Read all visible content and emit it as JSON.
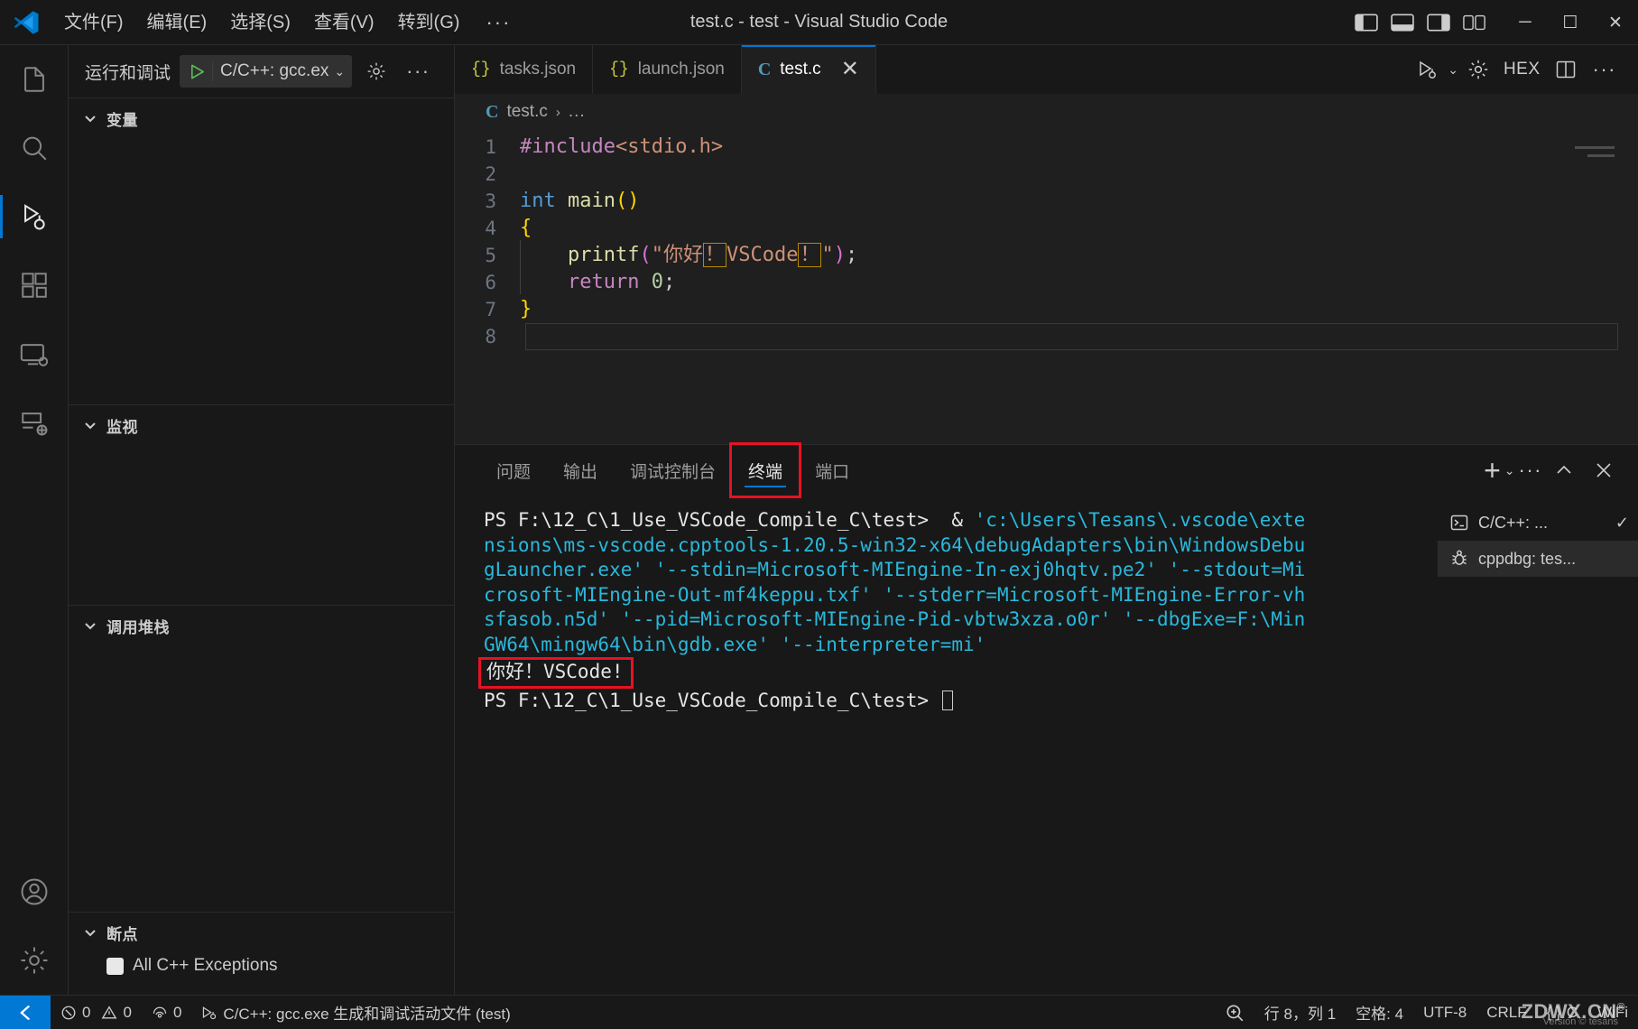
{
  "titlebar": {
    "window_title": "test.c - test - Visual Studio Code",
    "menus": [
      "文件(F)",
      "编辑(E)",
      "选择(S)",
      "查看(V)",
      "转到(G)"
    ],
    "more_label": "···",
    "minimize": "─",
    "maximize": "☐",
    "close": "✕"
  },
  "activitybar": {
    "items": [
      {
        "name": "explorer",
        "title": "资源管理器"
      },
      {
        "name": "search",
        "title": "搜索"
      },
      {
        "name": "run-debug",
        "title": "运行和调试"
      },
      {
        "name": "extensions",
        "title": "扩展"
      },
      {
        "name": "remote-explorer",
        "title": "远程资源管理器"
      },
      {
        "name": "testing",
        "title": "测试"
      }
    ],
    "bottom": [
      {
        "name": "accounts",
        "title": "账户"
      },
      {
        "name": "settings",
        "title": "管理"
      }
    ]
  },
  "sidebar": {
    "toolbar": {
      "label": "运行和调试",
      "launch_config": "C/C++: gcc.ex",
      "chevron": "⌄",
      "gear_title": "打开“launch.json”",
      "more": "···"
    },
    "panes": [
      {
        "title": "变量",
        "chevron": "⌄"
      },
      {
        "title": "监视",
        "chevron": "⌄"
      },
      {
        "title": "调用堆栈",
        "chevron": "⌄"
      },
      {
        "title": "断点",
        "chevron": "⌄"
      }
    ],
    "breakpoint_item": "All C++ Exceptions"
  },
  "editor": {
    "tabs": [
      {
        "label": "tasks.json",
        "icon": "{}",
        "active": false
      },
      {
        "label": "launch.json",
        "icon": "{}",
        "active": false
      },
      {
        "label": "test.c",
        "icon": "C",
        "active": true
      }
    ],
    "tab_close": "✕",
    "actions": {
      "run_label": "运行或调试",
      "chevron": "⌄",
      "gear": "设置",
      "hex": "HEX",
      "split": "拆分编辑器",
      "more": "···"
    },
    "breadcrumb": {
      "icon": "C",
      "file": "test.c",
      "separator": "›",
      "more": "..."
    },
    "code_lines": [
      {
        "n": "1",
        "text": "#include<stdio.h>"
      },
      {
        "n": "2",
        "text": ""
      },
      {
        "n": "3",
        "text": "int main()"
      },
      {
        "n": "4",
        "text": "{"
      },
      {
        "n": "5",
        "text": "    printf(\"你好！VSCode！\");"
      },
      {
        "n": "6",
        "text": "    return 0;"
      },
      {
        "n": "7",
        "text": "}"
      },
      {
        "n": "8",
        "text": ""
      }
    ]
  },
  "panel": {
    "tabs": [
      {
        "label": "问题",
        "active": false,
        "highlighted": false
      },
      {
        "label": "输出",
        "active": false,
        "highlighted": false
      },
      {
        "label": "调试控制台",
        "active": false,
        "highlighted": false
      },
      {
        "label": "终端",
        "active": true,
        "highlighted": true
      },
      {
        "label": "端口",
        "active": false,
        "highlighted": false
      }
    ],
    "actions": {
      "new_terminal": "+",
      "chevron": "⌄",
      "more": "···",
      "maximize": "⌃",
      "close": "✕"
    },
    "terminal": {
      "lines": [
        {
          "segments": [
            {
              "t": "PS F:\\12_C\\1_Use_VSCode_Compile_C\\test>  & ",
              "c": "white"
            },
            {
              "t": "'c:\\Users\\Tesans\\.vscode\\exte",
              "c": "cyan"
            }
          ]
        },
        {
          "segments": [
            {
              "t": "nsions\\ms-vscode.cpptools-1.20.5-win32-x64\\debugAdapters\\bin\\WindowsDebu",
              "c": "cyan"
            }
          ]
        },
        {
          "segments": [
            {
              "t": "gLauncher.exe' '--stdin=Microsoft-MIEngine-In-exj0hqtv.pe2' '--stdout=Mi",
              "c": "cyan"
            }
          ]
        },
        {
          "segments": [
            {
              "t": "crosoft-MIEngine-Out-mf4keppu.txf' '--stderr=Microsoft-MIEngine-Error-vh",
              "c": "cyan"
            }
          ]
        },
        {
          "segments": [
            {
              "t": "sfasob.n5d' '--pid=Microsoft-MIEngine-Pid-vbtw3xza.o0r' '--dbgExe=F:\\Min",
              "c": "cyan"
            }
          ]
        },
        {
          "segments": [
            {
              "t": "GW64\\mingw64\\bin\\gdb.exe' '--interpreter=mi'",
              "c": "cyan"
            }
          ]
        }
      ],
      "program_output": "你好！VSCode!",
      "prompt_line": "PS F:\\12_C\\1_Use_VSCode_Compile_C\\test> "
    },
    "terminal_list": [
      {
        "label": "C/C++: ...",
        "icon": "terminal-icon",
        "active": false,
        "check": "✓"
      },
      {
        "label": "cppdbg: tes...",
        "icon": "debug-icon",
        "active": true,
        "check": ""
      }
    ]
  },
  "statusbar": {
    "remote_icon": "remote-window-icon",
    "errors": "0",
    "warnings": "0",
    "ports": "0",
    "debug_task": "C/C++: gcc.exe 生成和调试活动文件 (test)",
    "zoom_icon": "screencast-icon",
    "cursor_position": "行 8，列 1",
    "indentation": "空格: 4",
    "encoding": "UTF-8",
    "eol": "CRLF",
    "language_icon": "{ }",
    "language": "C",
    "feedback": "WiFi"
  },
  "watermark": {
    "text": "ZDWX.CN",
    "sup": "®",
    "sub": "Version © tesans"
  },
  "colors": {
    "accent": "#0078d4",
    "highlight_box": "#e81123",
    "titlebar_bg": "#181818",
    "editor_bg": "#1f1f1f",
    "terminal_cyan": "#29b8db"
  }
}
